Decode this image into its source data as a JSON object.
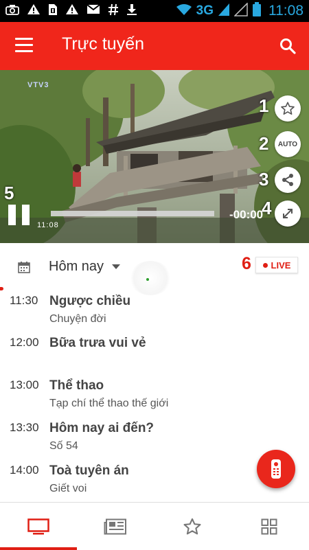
{
  "status_bar": {
    "network": "3G",
    "time": "11:08",
    "left_icons": [
      "camera-icon",
      "warning-icon",
      "sim-icon",
      "warning-icon",
      "gmail-icon",
      "hash-icon",
      "download-icon"
    ],
    "right_icons": [
      "wifi-icon",
      "signal-icon",
      "no-signal-icon",
      "battery-icon"
    ]
  },
  "app_bar": {
    "title": "Trực tuyến",
    "color": "#f0261b"
  },
  "player": {
    "channel_logo": "VTV3",
    "overlay_time": "11:08",
    "timecode": "-00:00",
    "quality_label": "AUTO",
    "progress": 1.0,
    "annotation_numbers": [
      "1",
      "2",
      "3",
      "4",
      "5"
    ]
  },
  "date_selector": {
    "label": "Hôm nay"
  },
  "live": {
    "annotation_number": "6",
    "label": "LIVE",
    "color": "#e01f14"
  },
  "schedule": [
    {
      "time": "11:30",
      "title": "Ngược chiều",
      "subtitle": "Chuyện đời"
    },
    {
      "time": "12:00",
      "title": "Bữa trưa vui vẻ",
      "subtitle": ""
    },
    {
      "time": "13:00",
      "title": "Thể thao",
      "subtitle": "Tạp chí thể thao thế giới"
    },
    {
      "time": "13:30",
      "title": "Hôm nay ai đến?",
      "subtitle": "Số 54"
    },
    {
      "time": "14:00",
      "title": "Toà tuyên án",
      "subtitle": "Giết voi"
    }
  ],
  "bottom_nav": {
    "items": [
      "tv-icon",
      "news-icon",
      "star-icon",
      "grid-icon"
    ],
    "active_index": 0
  }
}
